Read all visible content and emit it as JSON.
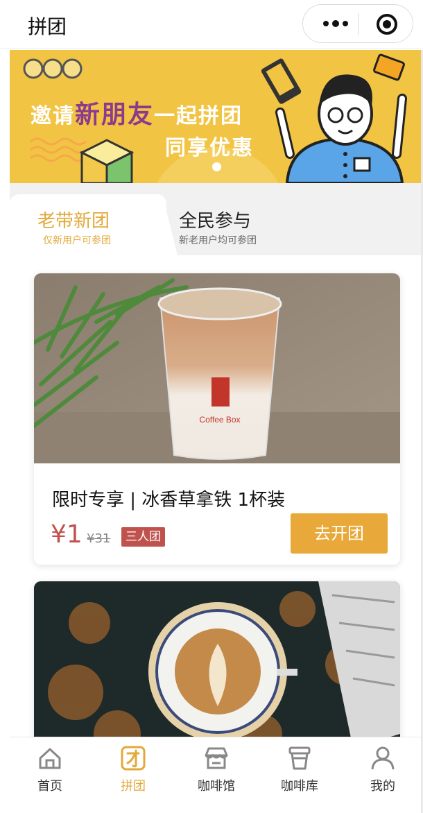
{
  "header": {
    "title": "拼团"
  },
  "banner": {
    "line1_prefix": "邀请",
    "line1_highlight": "新朋友",
    "line1_suffix": "一起拼团",
    "line2": "同享优惠"
  },
  "tabs": [
    {
      "title": "老带新团",
      "subtitle": "仅新用户可参团",
      "active": true
    },
    {
      "title": "全民参与",
      "subtitle": "新老用户均可参团",
      "active": false
    }
  ],
  "products": [
    {
      "name": "限时专享 | 冰香草拿铁 1杯装",
      "price": "¥1",
      "original_price": "¥31",
      "group_tag": "三人团",
      "button": "去开团",
      "cup_brand": "Coffee Box"
    }
  ],
  "bottom_nav": [
    {
      "label": "首页",
      "icon": "home-icon",
      "active": false
    },
    {
      "label": "拼团",
      "icon": "group-buy-icon",
      "active": true
    },
    {
      "label": "咖啡馆",
      "icon": "cafe-store-icon",
      "active": false
    },
    {
      "label": "咖啡库",
      "icon": "coffee-cup-icon",
      "active": false
    },
    {
      "label": "我的",
      "icon": "profile-icon",
      "active": false
    }
  ],
  "colors": {
    "accent": "#e2a93a",
    "price_red": "#c0524e",
    "banner_yellow": "#f2c443"
  }
}
